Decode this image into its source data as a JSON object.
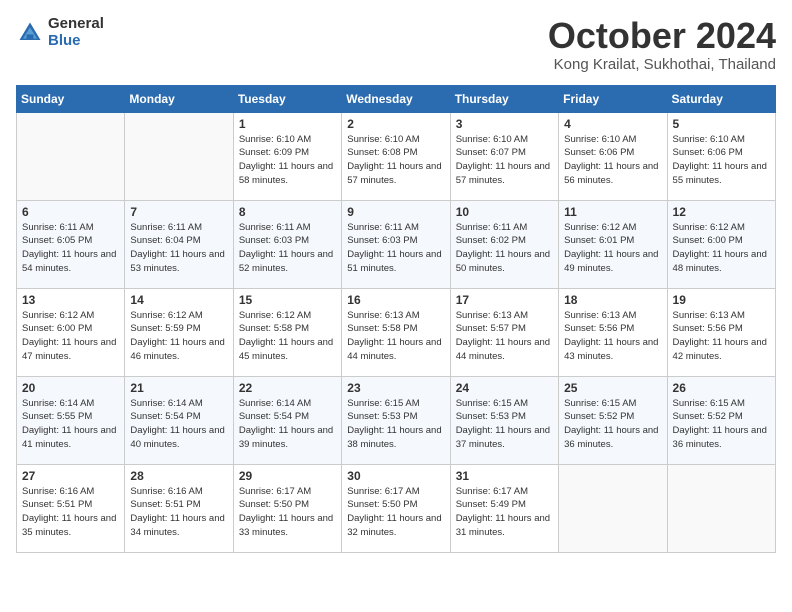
{
  "header": {
    "logo_general": "General",
    "logo_blue": "Blue",
    "month_title": "October 2024",
    "subtitle": "Kong Krailat, Sukhothai, Thailand"
  },
  "days_of_week": [
    "Sunday",
    "Monday",
    "Tuesday",
    "Wednesday",
    "Thursday",
    "Friday",
    "Saturday"
  ],
  "weeks": [
    [
      {
        "day": "",
        "content": ""
      },
      {
        "day": "",
        "content": ""
      },
      {
        "day": "1",
        "content": "Sunrise: 6:10 AM\nSunset: 6:09 PM\nDaylight: 11 hours\nand 58 minutes."
      },
      {
        "day": "2",
        "content": "Sunrise: 6:10 AM\nSunset: 6:08 PM\nDaylight: 11 hours\nand 57 minutes."
      },
      {
        "day": "3",
        "content": "Sunrise: 6:10 AM\nSunset: 6:07 PM\nDaylight: 11 hours\nand 57 minutes."
      },
      {
        "day": "4",
        "content": "Sunrise: 6:10 AM\nSunset: 6:06 PM\nDaylight: 11 hours\nand 56 minutes."
      },
      {
        "day": "5",
        "content": "Sunrise: 6:10 AM\nSunset: 6:06 PM\nDaylight: 11 hours\nand 55 minutes."
      }
    ],
    [
      {
        "day": "6",
        "content": "Sunrise: 6:11 AM\nSunset: 6:05 PM\nDaylight: 11 hours\nand 54 minutes."
      },
      {
        "day": "7",
        "content": "Sunrise: 6:11 AM\nSunset: 6:04 PM\nDaylight: 11 hours\nand 53 minutes."
      },
      {
        "day": "8",
        "content": "Sunrise: 6:11 AM\nSunset: 6:03 PM\nDaylight: 11 hours\nand 52 minutes."
      },
      {
        "day": "9",
        "content": "Sunrise: 6:11 AM\nSunset: 6:03 PM\nDaylight: 11 hours\nand 51 minutes."
      },
      {
        "day": "10",
        "content": "Sunrise: 6:11 AM\nSunset: 6:02 PM\nDaylight: 11 hours\nand 50 minutes."
      },
      {
        "day": "11",
        "content": "Sunrise: 6:12 AM\nSunset: 6:01 PM\nDaylight: 11 hours\nand 49 minutes."
      },
      {
        "day": "12",
        "content": "Sunrise: 6:12 AM\nSunset: 6:00 PM\nDaylight: 11 hours\nand 48 minutes."
      }
    ],
    [
      {
        "day": "13",
        "content": "Sunrise: 6:12 AM\nSunset: 6:00 PM\nDaylight: 11 hours\nand 47 minutes."
      },
      {
        "day": "14",
        "content": "Sunrise: 6:12 AM\nSunset: 5:59 PM\nDaylight: 11 hours\nand 46 minutes."
      },
      {
        "day": "15",
        "content": "Sunrise: 6:12 AM\nSunset: 5:58 PM\nDaylight: 11 hours\nand 45 minutes."
      },
      {
        "day": "16",
        "content": "Sunrise: 6:13 AM\nSunset: 5:58 PM\nDaylight: 11 hours\nand 44 minutes."
      },
      {
        "day": "17",
        "content": "Sunrise: 6:13 AM\nSunset: 5:57 PM\nDaylight: 11 hours\nand 44 minutes."
      },
      {
        "day": "18",
        "content": "Sunrise: 6:13 AM\nSunset: 5:56 PM\nDaylight: 11 hours\nand 43 minutes."
      },
      {
        "day": "19",
        "content": "Sunrise: 6:13 AM\nSunset: 5:56 PM\nDaylight: 11 hours\nand 42 minutes."
      }
    ],
    [
      {
        "day": "20",
        "content": "Sunrise: 6:14 AM\nSunset: 5:55 PM\nDaylight: 11 hours\nand 41 minutes."
      },
      {
        "day": "21",
        "content": "Sunrise: 6:14 AM\nSunset: 5:54 PM\nDaylight: 11 hours\nand 40 minutes."
      },
      {
        "day": "22",
        "content": "Sunrise: 6:14 AM\nSunset: 5:54 PM\nDaylight: 11 hours\nand 39 minutes."
      },
      {
        "day": "23",
        "content": "Sunrise: 6:15 AM\nSunset: 5:53 PM\nDaylight: 11 hours\nand 38 minutes."
      },
      {
        "day": "24",
        "content": "Sunrise: 6:15 AM\nSunset: 5:53 PM\nDaylight: 11 hours\nand 37 minutes."
      },
      {
        "day": "25",
        "content": "Sunrise: 6:15 AM\nSunset: 5:52 PM\nDaylight: 11 hours\nand 36 minutes."
      },
      {
        "day": "26",
        "content": "Sunrise: 6:15 AM\nSunset: 5:52 PM\nDaylight: 11 hours\nand 36 minutes."
      }
    ],
    [
      {
        "day": "27",
        "content": "Sunrise: 6:16 AM\nSunset: 5:51 PM\nDaylight: 11 hours\nand 35 minutes."
      },
      {
        "day": "28",
        "content": "Sunrise: 6:16 AM\nSunset: 5:51 PM\nDaylight: 11 hours\nand 34 minutes."
      },
      {
        "day": "29",
        "content": "Sunrise: 6:17 AM\nSunset: 5:50 PM\nDaylight: 11 hours\nand 33 minutes."
      },
      {
        "day": "30",
        "content": "Sunrise: 6:17 AM\nSunset: 5:50 PM\nDaylight: 11 hours\nand 32 minutes."
      },
      {
        "day": "31",
        "content": "Sunrise: 6:17 AM\nSunset: 5:49 PM\nDaylight: 11 hours\nand 31 minutes."
      },
      {
        "day": "",
        "content": ""
      },
      {
        "day": "",
        "content": ""
      }
    ]
  ]
}
